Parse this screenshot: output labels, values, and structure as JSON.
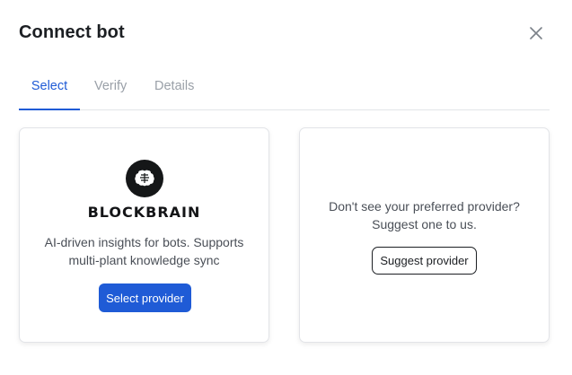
{
  "dialog": {
    "title": "Connect bot"
  },
  "tabs": [
    {
      "label": "Select",
      "active": true
    },
    {
      "label": "Verify",
      "active": false
    },
    {
      "label": "Details",
      "active": false
    }
  ],
  "provider_card": {
    "logo_text": "BLOCKBRAIN",
    "description_line1": "AI-driven insights for bots. Supports",
    "description_line2": "multi-plant knowledge sync",
    "button_label": "Select provider"
  },
  "suggest_card": {
    "text_line1": "Don't see your preferred provider?",
    "text_line2": "Suggest one to us.",
    "button_label": "Suggest provider"
  },
  "icons": {
    "close": "close-icon",
    "logo": "brain-icon"
  },
  "colors": {
    "accent": "#1f5bd6",
    "inactive_tab": "#9aa0a8"
  }
}
